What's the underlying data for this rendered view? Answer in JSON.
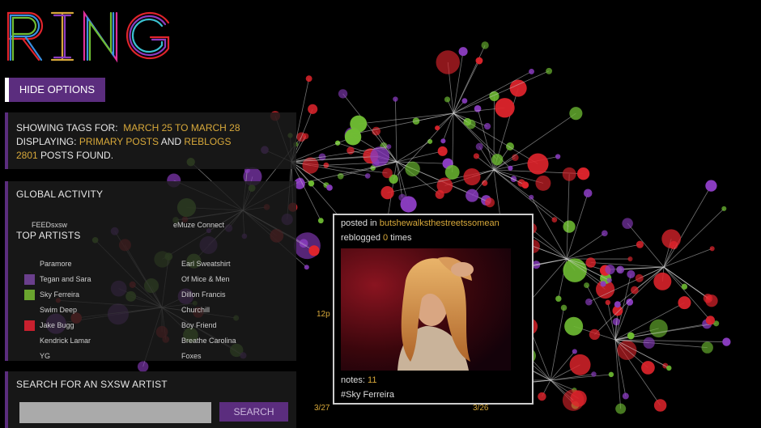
{
  "logo": {
    "text": "RING"
  },
  "buttons": {
    "hide_options": "HIDE OPTIONS",
    "search": "SEARCH"
  },
  "info": {
    "showing_label": "SHOWING TAGS FOR:",
    "date_range": "MARCH 25 TO MARCH 28",
    "displaying_label": "DISPLAYING:",
    "primary_posts": "PRIMARY POSTS",
    "and": "AND",
    "reblogs": "REBLOGS",
    "post_count": "2801",
    "posts_found": "POSTS FOUND."
  },
  "global_activity": {
    "title": "GLOBAL ACTIVITY",
    "items": [
      "FEEDsxsw",
      "eMuze Connect"
    ]
  },
  "top_artists": {
    "title": "TOP ARTISTS",
    "left": [
      {
        "name": "Paramore",
        "color": ""
      },
      {
        "name": "Tegan and Sara",
        "color": "#6a3f8c"
      },
      {
        "name": "Sky Ferreira",
        "color": "#6aa52e"
      },
      {
        "name": "Swim Deep",
        "color": ""
      },
      {
        "name": "Jake Bugg",
        "color": "#c8202e"
      },
      {
        "name": "Kendrick Lamar",
        "color": ""
      },
      {
        "name": "YG",
        "color": ""
      }
    ],
    "right": [
      "Earl Sweatshirt",
      "Of Mice & Men",
      "Dillon Francis",
      "Churchill",
      "Boy Friend",
      "Breathe Carolina",
      "Foxes"
    ]
  },
  "search": {
    "title": "SEARCH FOR AN SXSW ARTIST",
    "value": "",
    "placeholder": ""
  },
  "axis": {
    "noon": "12p",
    "date1": "3/27",
    "date2": "3/26"
  },
  "tooltip": {
    "posted_in": "posted in",
    "blog_name": "butshewalksthestreetssomean",
    "reblogged": "reblogged",
    "reblog_count": "0",
    "times": "times",
    "notes_label": "notes:",
    "notes_count": "11",
    "tag": "#Sky Ferreira"
  },
  "colors": {
    "purple": "#8a3cc0",
    "red": "#e0242c",
    "green": "#6fbd33",
    "accent": "#5b2d7e",
    "gold": "#d7a83a"
  }
}
